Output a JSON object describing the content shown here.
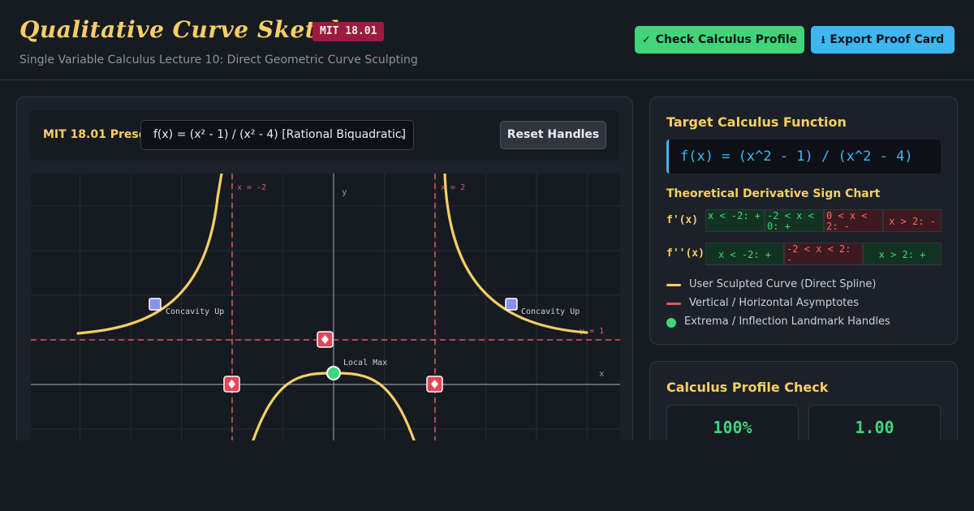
{
  "header": {
    "title": "Qualitative Curve Sketcher",
    "badge": "MIT 18.01",
    "subtitle": "Single Variable Calculus Lecture 10: Direct Geometric Curve Sculpting",
    "check_button": "Check Calculus Profile",
    "export_button": "Export Proof Card"
  },
  "toolbar": {
    "preset_label": "MIT 18.01 Preset:",
    "preset_value": "f(x) = (x² - 1) / (x² - 4) [Rational Biquadratic]",
    "reset_button": "Reset Handles"
  },
  "plot": {
    "axis_x_label": "x",
    "axis_y_label": "y",
    "asymptote_left_label": "x = -2",
    "asymptote_right_label": "x = 2",
    "horizontal_asymptote_label": "y = 1",
    "local_max_label": "Local Max",
    "concavity_left_label": "Concavity Up",
    "concavity_right_label": "Concavity Up",
    "colors": {
      "curve": "#f7cf62",
      "asymptote": "#e05a5a",
      "extrema": "#3fd67a",
      "concavity_handle": "#8891f2"
    }
  },
  "target": {
    "heading": "Target Calculus Function",
    "function": "f(x) = (x^2 - 1) / (x^2 - 4)",
    "sign_chart_heading": "Theoretical Derivative Sign Chart",
    "first_derivative": {
      "label": "f'(x)",
      "cells": [
        {
          "text": "x < -2: +",
          "sign": "pos"
        },
        {
          "text": "-2 < x < 0: +",
          "sign": "pos"
        },
        {
          "text": "0 < x < 2: -",
          "sign": "neg"
        },
        {
          "text": "x > 2: -",
          "sign": "neg"
        }
      ]
    },
    "second_derivative": {
      "label": "f''(x)",
      "cells": [
        {
          "text": "x < -2: +",
          "sign": "pos"
        },
        {
          "text": "-2 < x < 2: -",
          "sign": "neg"
        },
        {
          "text": "x > 2: +",
          "sign": "pos"
        }
      ]
    },
    "legend": [
      {
        "label": "User Sculpted Curve (Direct Spline)",
        "color": "#f7cf62",
        "kind": "line"
      },
      {
        "label": "Vertical / Horizontal Asymptotes",
        "color": "#e05a5a",
        "kind": "line"
      },
      {
        "label": "Extrema / Inflection Landmark Handles",
        "color": "#3fd67a",
        "kind": "dot"
      }
    ]
  },
  "profile": {
    "heading": "Calculus Profile Check",
    "match_value": "100%",
    "score_value": "1.00"
  }
}
